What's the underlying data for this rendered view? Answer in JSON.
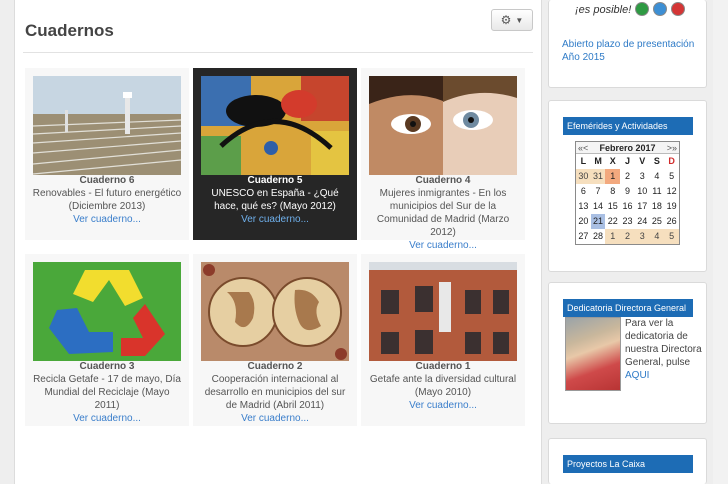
{
  "main": {
    "title": "Cuadernos",
    "cards": [
      {
        "name": "Cuaderno 6",
        "desc": "Renovables - El futuro energético (Diciembre 2013)",
        "link": "Ver cuaderno..."
      },
      {
        "name": "Cuaderno 5",
        "desc": "UNESCO en España - ¿Qué hace, qué es? (Mayo 2012)",
        "link": "Ver cuaderno..."
      },
      {
        "name": "Cuaderno 4",
        "desc": "Mujeres inmigrantes - En los municipios del Sur de la Comunidad de Madrid (Marzo 2012)",
        "link": "Ver cuaderno..."
      },
      {
        "name": "Cuaderno 3",
        "desc": "Recicla Getafe - 17 de mayo, Día Mundial del Reciclaje (Mayo 2011)",
        "link": "Ver cuaderno..."
      },
      {
        "name": "Cuaderno 2",
        "desc": "Cooperación internacional al desarrollo en municipios del sur de Madrid (Abril 2011)",
        "link": "Ver cuaderno..."
      },
      {
        "name": "Cuaderno 1",
        "desc": "Getafe ante la diversidad cultural (Mayo 2010)",
        "link": "Ver cuaderno..."
      }
    ]
  },
  "sidebar": {
    "slogan": "¡es posible!",
    "news_link": "Abierto plazo de presentación Año 2015",
    "calendar": {
      "heading": "Efemérides y Actividades",
      "month": "Febrero 2017",
      "prev": "«<",
      "next": ">»",
      "day_names": [
        "L",
        "M",
        "X",
        "J",
        "V",
        "S",
        "D"
      ],
      "weeks": [
        [
          "30",
          "31",
          "1",
          "2",
          "3",
          "4",
          "5"
        ],
        [
          "6",
          "7",
          "8",
          "9",
          "10",
          "11",
          "12"
        ],
        [
          "13",
          "14",
          "15",
          "16",
          "17",
          "18",
          "19"
        ],
        [
          "20",
          "21",
          "22",
          "23",
          "24",
          "25",
          "26"
        ],
        [
          "27",
          "28",
          "1",
          "2",
          "3",
          "4",
          "5"
        ]
      ]
    },
    "dedicatoria": {
      "heading": "Dedicatoria Directora General",
      "text": "Para ver la dedicatoria de nuestra Directora General, pulse",
      "link": "AQUI"
    },
    "proyectos": {
      "heading": "Proyectos La Caixa"
    }
  },
  "colors": {
    "accent": "#1d6cb5",
    "link": "#3a7ecb",
    "active_card": "#262626",
    "calendar_other_month": "#f6dfbe",
    "calendar_event": "#f3a97e",
    "calendar_today": "#a9bfe3",
    "sunday": "#d02a2a"
  }
}
